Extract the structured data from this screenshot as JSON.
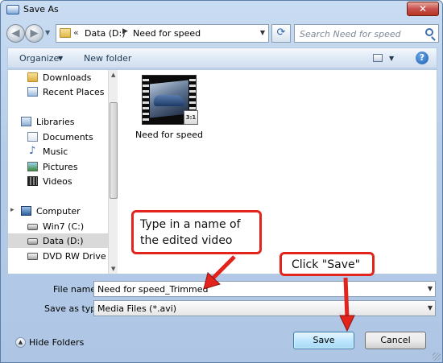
{
  "window": {
    "title": "Save As",
    "close_glyph": "✕"
  },
  "nav": {
    "back_glyph": "◀",
    "forward_glyph": "▶",
    "dropdown_glyph": "▼",
    "breadcrumb_sep1": "«",
    "breadcrumb_sep2": "▶",
    "breadcrumbs": [
      "Data (D:)",
      "Need for speed"
    ],
    "refresh_glyph": "⟳",
    "search_placeholder": "Search Need for speed"
  },
  "toolbar": {
    "organize": "Organize",
    "organize_arrow": "▼",
    "new_folder": "New folder",
    "views_arrow": "▼",
    "help_glyph": "?"
  },
  "sidebar": {
    "items": [
      {
        "label": "Downloads"
      },
      {
        "label": "Recent Places"
      },
      {
        "label": "Libraries"
      },
      {
        "label": "Documents"
      },
      {
        "label": "Music"
      },
      {
        "label": "Pictures"
      },
      {
        "label": "Videos"
      },
      {
        "label": "Computer"
      },
      {
        "label": "Win7 (C:)"
      },
      {
        "label": "Data (D:)"
      },
      {
        "label": "DVD RW Drive (E:"
      }
    ],
    "expand_glyph": "▸",
    "scroll_up": "▲",
    "scroll_down": "▼"
  },
  "files": [
    {
      "name": "Need for speed",
      "badge": "3:1"
    }
  ],
  "form": {
    "filename_label": "File name:",
    "filename_value": "Need for speed_Trimmed",
    "savetype_label": "Save as type:",
    "savetype_value": "Media Files (*.avi)",
    "dropdown_glyph": "▼"
  },
  "footer": {
    "hide_folders": "Hide Folders",
    "hide_glyph": "▲",
    "save": "Save",
    "cancel": "Cancel"
  },
  "annotations": {
    "name_callout": "Type in a name of the edited video",
    "save_callout": "Click \"Save\"",
    "accent_color": "#e2241c"
  }
}
